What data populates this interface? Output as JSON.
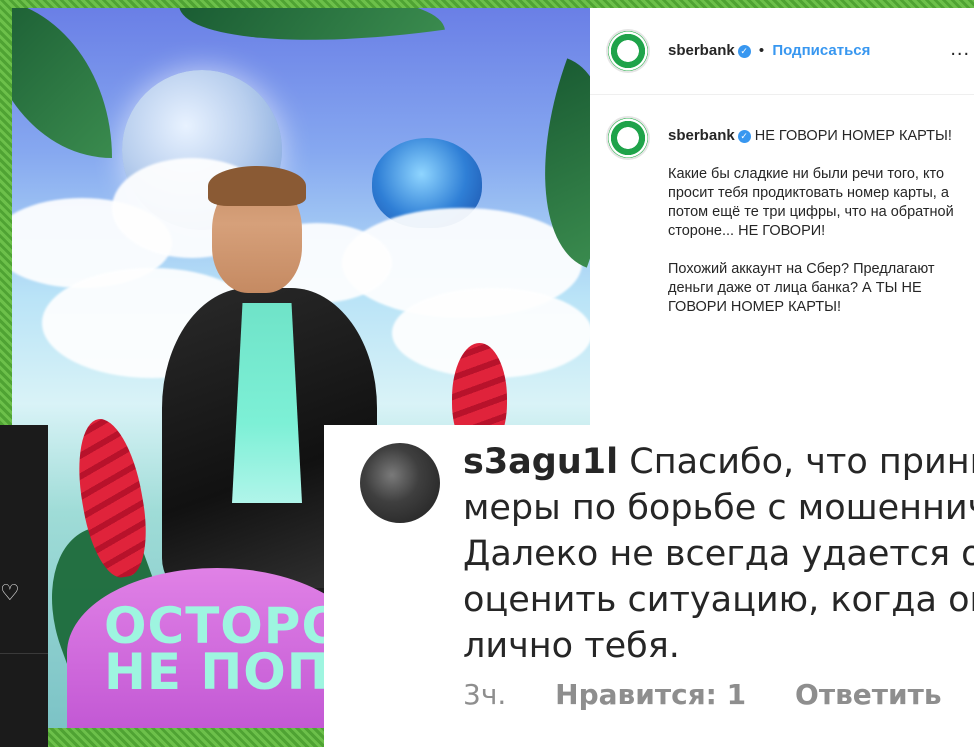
{
  "instagram_post": {
    "header": {
      "username": "sberbank",
      "separator": "•",
      "follow_label": "Подписаться",
      "more_label": "..."
    },
    "caption": {
      "username": "sberbank",
      "headline": "НЕ ГОВОРИ НОМЕР КАРТЫ!",
      "paragraph_1": "Какие бы сладкие ни были речи того, кто просит тебя продиктовать номер карты, а потом ещё те три цифры, что на обратной стороне... НЕ ГОВОРИ!",
      "paragraph_2": "Похожий аккаунт на Сбер? Предлагают деньги даже от лица банка? А ТЫ НЕ ГОВОРИ НОМЕР КАРТЫ!"
    }
  },
  "poster": {
    "line_1": "ОСТОРО",
    "line_2": "НЕ ПОПА"
  },
  "comment": {
    "username": "s3agu1l",
    "line_1": "Спасибо, что прини",
    "line_2": "меры по борьбе с мошеннич",
    "line_3": "Далеко не всегда удается об",
    "line_4": "оценить ситуацию, когда он",
    "line_5": "лично тебя.",
    "time": "3ч.",
    "likes_label": "Нравится: 1",
    "reply_label": "Ответить"
  },
  "dark_card": {
    "icon": "heart-icon"
  },
  "colors": {
    "follow_blue": "#3897f0",
    "verified_blue": "#3897f0",
    "sber_green": "#1fa34a",
    "background_green": "#5cb33c"
  }
}
